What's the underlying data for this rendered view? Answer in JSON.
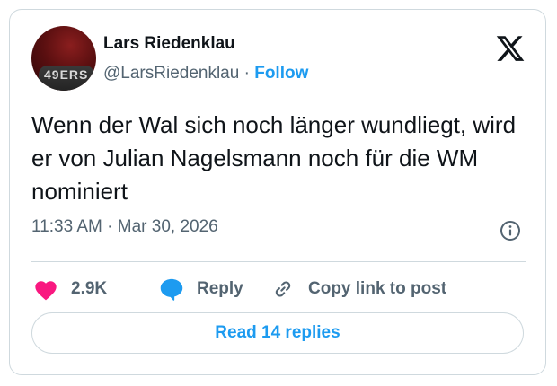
{
  "user": {
    "display_name": "Lars Riedenklau",
    "handle": "@LarsRiedenklau",
    "separator": "·",
    "follow_label": "Follow",
    "avatar_jersey_text": "49ERS"
  },
  "tweet": {
    "text": "Wenn der Wal sich noch länger wundliegt, wird er von Julian Nagelsmann noch für die WM nominiert",
    "timestamp": "11:33 AM · Mar 30, 2026"
  },
  "actions": {
    "like_count": "2.9K",
    "reply_label": "Reply",
    "copy_label": "Copy link to post"
  },
  "footer": {
    "read_replies_label": "Read 14 replies"
  },
  "colors": {
    "like_heart": "#f91880",
    "reply_bubble": "#1d9bf0",
    "link_blue": "#1d9bf0",
    "muted_text": "#536471",
    "border": "#cfd9de"
  },
  "icons": {
    "brand": "x-logo-icon",
    "info": "info-icon",
    "like": "heart-icon",
    "reply": "reply-bubble-icon",
    "copy": "link-icon"
  }
}
